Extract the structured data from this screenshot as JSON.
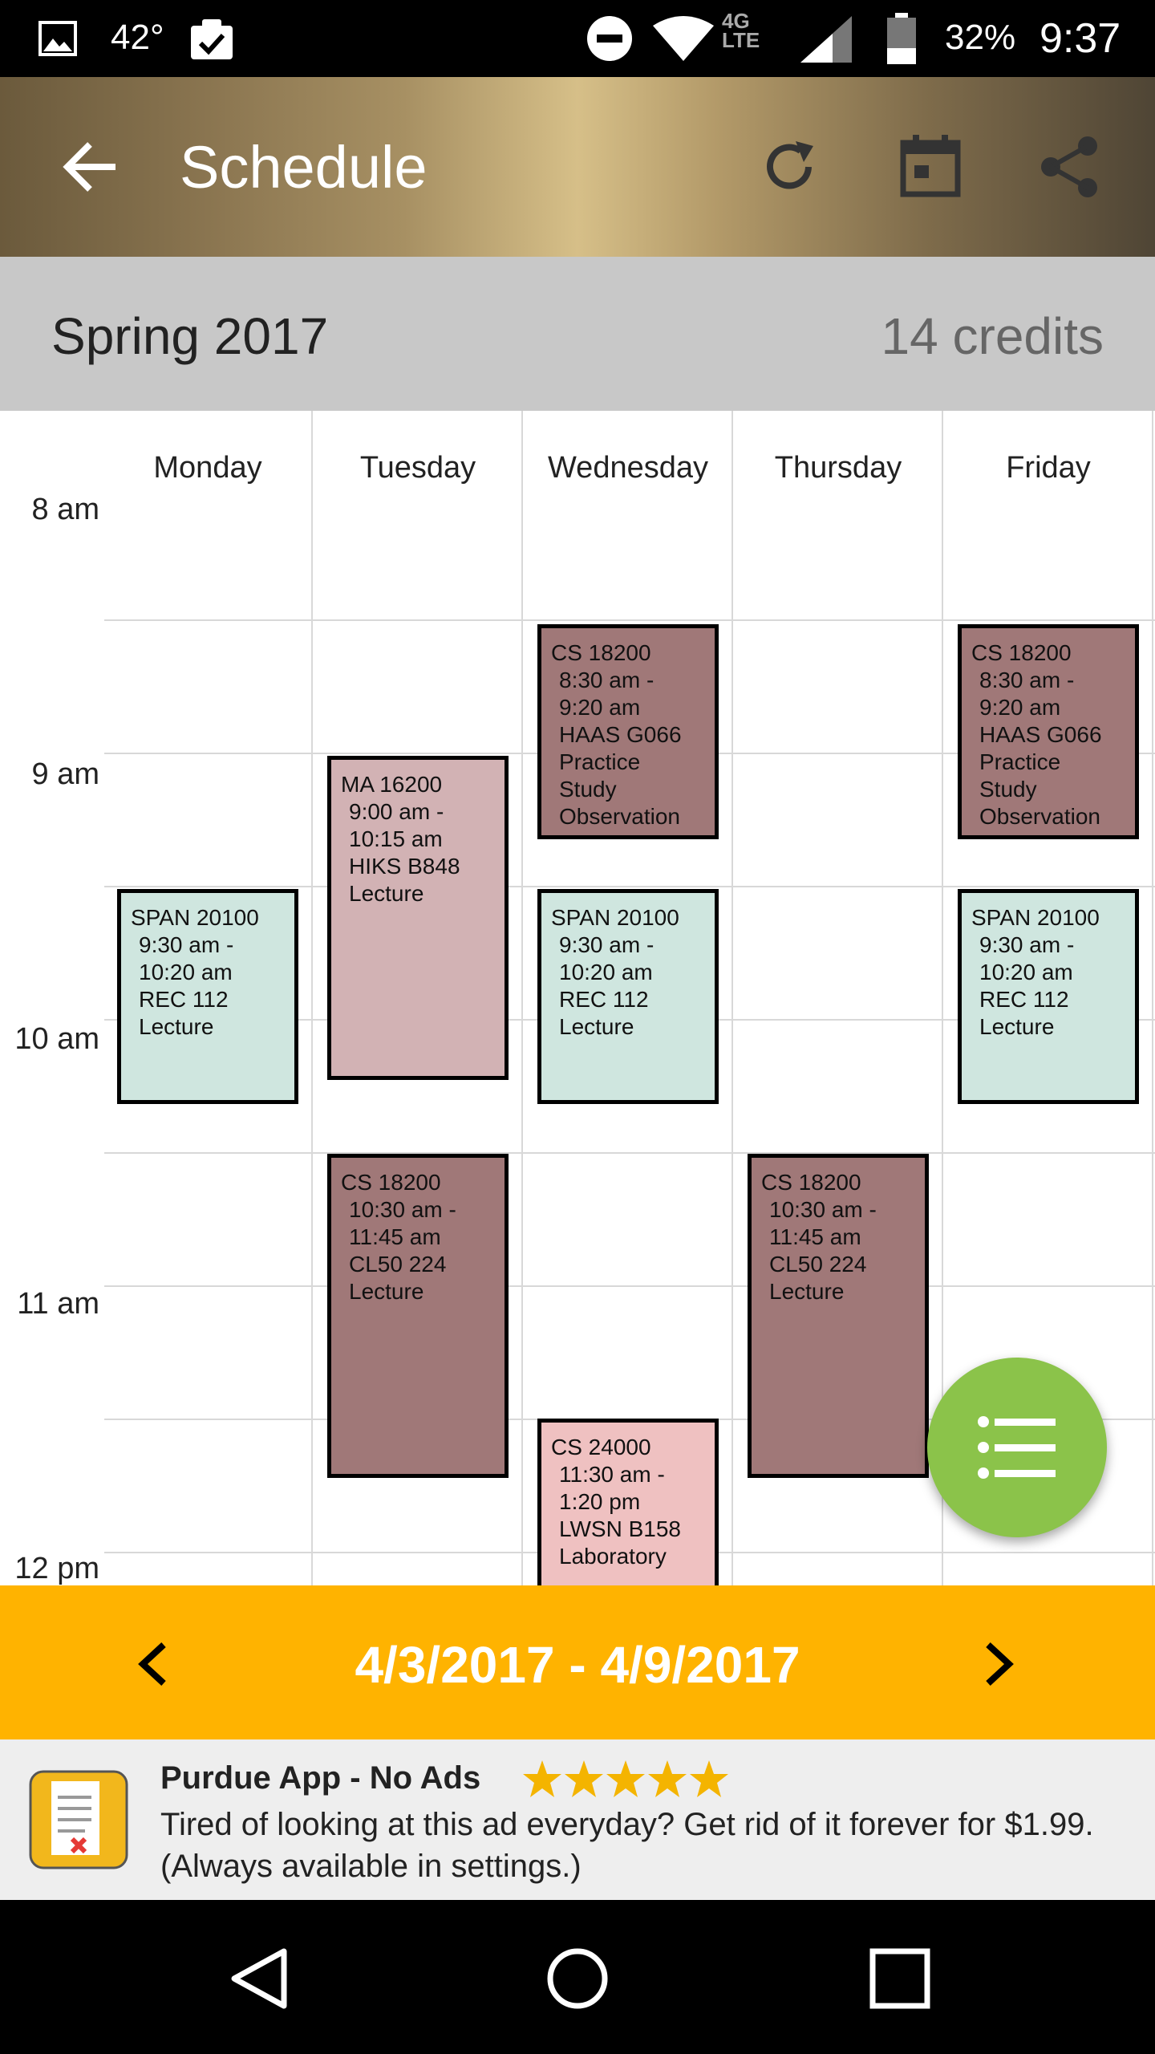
{
  "status_bar": {
    "temperature": "42°",
    "network": "4G LTE",
    "battery": "32%",
    "time": "9:37"
  },
  "toolbar": {
    "title": "Schedule",
    "icons": [
      "arrow-back-icon",
      "refresh-icon",
      "calendar-icon",
      "share-icon"
    ]
  },
  "term": {
    "name": "Spring 2017",
    "credits": "14 credits"
  },
  "calendar": {
    "days": [
      "Monday",
      "Tuesday",
      "Wednesday",
      "Thursday",
      "Friday"
    ],
    "time_labels": [
      "8 am",
      "9 am",
      "10 am",
      "11 am",
      "12 pm"
    ],
    "events": [
      {
        "day": "Monday",
        "code": "SPAN 20100",
        "time": "9:30 am - 10:20 am",
        "lines": [
          "9:30 am -",
          "10:20 am",
          "REC 112",
          "Lecture"
        ],
        "color": "#cfe6df"
      },
      {
        "day": "Tuesday",
        "code": "MA 16200",
        "time": "9:00 am - 10:15 am",
        "lines": [
          "9:00 am -",
          "10:15 am",
          "HIKS B848",
          "Lecture"
        ],
        "color": "#d2b2b4"
      },
      {
        "day": "Tuesday",
        "code": "CS 18200",
        "time": "10:30 am - 11:45 am",
        "lines": [
          "10:30 am -",
          "11:45 am",
          "CL50 224",
          "Lecture"
        ],
        "color": "#a07878"
      },
      {
        "day": "Wednesday",
        "code": "CS 18200",
        "time": "8:30 am - 9:20 am",
        "lines": [
          "8:30 am -",
          "9:20 am",
          "HAAS G066",
          "Practice",
          "Study",
          "Observation"
        ],
        "color": "#a07878"
      },
      {
        "day": "Wednesday",
        "code": "SPAN 20100",
        "time": "9:30 am - 10:20 am",
        "lines": [
          "9:30 am -",
          "10:20 am",
          "REC 112",
          "Lecture"
        ],
        "color": "#cfe6df"
      },
      {
        "day": "Wednesday",
        "code": "CS 24000",
        "time": "11:30 am - 1:20 pm",
        "lines": [
          "11:30 am -",
          "1:20 pm",
          "LWSN B158",
          "Laboratory"
        ],
        "color": "#efc1c1"
      },
      {
        "day": "Thursday",
        "code": "CS 18200",
        "time": "10:30 am - 11:45 am",
        "lines": [
          "10:30 am -",
          "11:45 am",
          "CL50 224",
          "Lecture"
        ],
        "color": "#a07878"
      },
      {
        "day": "Friday",
        "code": "CS 18200",
        "time": "8:30 am - 9:20 am",
        "lines": [
          "8:30 am -",
          "9:20 am",
          "HAAS G066",
          "Practice",
          "Study",
          "Observation"
        ],
        "color": "#a07878"
      },
      {
        "day": "Friday",
        "code": "SPAN 20100",
        "time": "9:30 am - 10:20 am",
        "lines": [
          "9:30 am -",
          "10:20 am",
          "REC 112",
          "Lecture"
        ],
        "color": "#cfe6df"
      }
    ]
  },
  "fab": {
    "icon": "list-icon"
  },
  "week_nav": {
    "range": "4/3/2017 - 4/9/2017",
    "prev_icon": "chevron-left-icon",
    "next_icon": "chevron-right-icon"
  },
  "ad": {
    "title": "Purdue App - No Ads",
    "rating": 5,
    "text": "Tired of looking at this ad everyday? Get rid of it forever for $1.99. (Always available in settings.)",
    "icon": "app-document-icon"
  },
  "navbar": {
    "icons": [
      "back-nav-icon",
      "home-nav-icon",
      "recents-nav-icon"
    ]
  }
}
